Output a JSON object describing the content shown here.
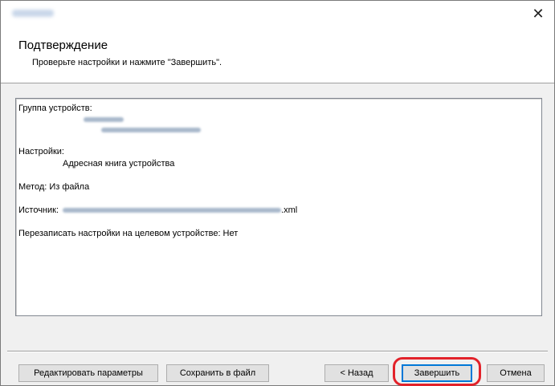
{
  "window": {
    "close_glyph": "✕"
  },
  "header": {
    "title": "Подтверждение",
    "subtitle": "Проверьте настройки и нажмите \"Завершить\"."
  },
  "summary": {
    "group_label": "Группа устройств:",
    "settings_label": "Настройки:",
    "settings_value": "Адресная книга устройства",
    "method_line": "Метод: Из файла",
    "source_label": "Источник:",
    "source_suffix": ".xml",
    "overwrite_line": "Перезаписать настройки на целевом устройстве: Нет"
  },
  "buttons": {
    "edit": "Редактировать параметры",
    "save": "Сохранить в файл",
    "back": "< Назад",
    "finish": "Завершить",
    "cancel": "Отмена"
  },
  "colors": {
    "highlight": "#e2222a",
    "focus": "#0078d7"
  }
}
